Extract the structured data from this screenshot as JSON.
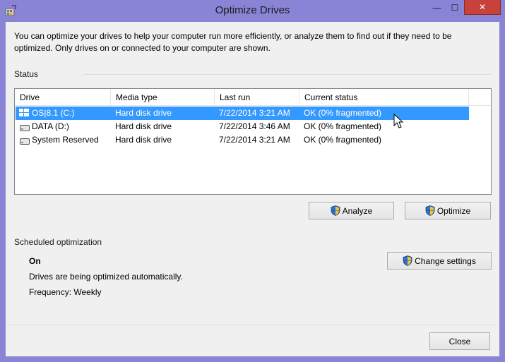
{
  "window": {
    "title": "Optimize Drives",
    "minimize_glyph": "—",
    "maximize_glyph": "☐",
    "close_glyph": "✕"
  },
  "intro": "You can optimize your drives to help your computer run more efficiently, or analyze them to find out if they need to be optimized. Only drives on or connected to your computer are shown.",
  "status": {
    "label": "Status",
    "columns": [
      "Drive",
      "Media type",
      "Last run",
      "Current status"
    ],
    "rows": [
      {
        "drive": "OS|8.1 (C:)",
        "media": "Hard disk drive",
        "last_run": "7/22/2014 3:21 AM",
        "status": "OK (0% fragmented)",
        "icon": "windows-drive-icon",
        "selected": true
      },
      {
        "drive": "DATA (D:)",
        "media": "Hard disk drive",
        "last_run": "7/22/2014 3:46 AM",
        "status": "OK (0% fragmented)",
        "icon": "hard-drive-icon",
        "selected": false
      },
      {
        "drive": "System Reserved",
        "media": "Hard disk drive",
        "last_run": "7/22/2014 3:21 AM",
        "status": "OK (0% fragmented)",
        "icon": "hard-drive-icon",
        "selected": false
      }
    ],
    "analyze_label": "Analyze",
    "optimize_label": "Optimize"
  },
  "scheduled": {
    "label": "Scheduled optimization",
    "state": "On",
    "description": "Drives are being optimized automatically.",
    "frequency": "Frequency: Weekly",
    "change_settings_label": "Change settings"
  },
  "footer": {
    "close_label": "Close"
  },
  "colors": {
    "titlebar": "#8a84d6",
    "selection": "#3399ff",
    "close_button": "#c7423a"
  }
}
